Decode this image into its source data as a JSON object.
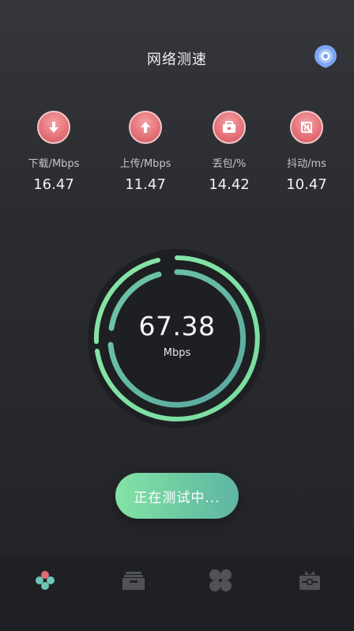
{
  "header": {
    "title": "网络测速",
    "pin_icon": "location-pin-icon"
  },
  "stats": [
    {
      "icon": "download-arrow-icon",
      "label": "下载/Mbps",
      "value": "16.47"
    },
    {
      "icon": "upload-arrow-icon",
      "label": "上传/Mbps",
      "value": "11.47"
    },
    {
      "icon": "briefcase-icon",
      "label": "丢包/%",
      "value": "14.42"
    },
    {
      "icon": "no-signal-icon",
      "label": "抖动/ms",
      "value": "10.47"
    }
  ],
  "gauge": {
    "speed": "67.38",
    "unit": "Mbps"
  },
  "test_button": {
    "label": "正在测试中..."
  },
  "tabbar": [
    {
      "icon": "speed-test-icon",
      "active": true
    },
    {
      "icon": "inbox-tray-icon",
      "active": false
    },
    {
      "icon": "fan-icon",
      "active": false
    },
    {
      "icon": "toolbox-icon",
      "active": false
    }
  ],
  "colors": {
    "accent_green": "#84e3a6",
    "accent_teal": "#5fb5a3",
    "badge_red": "#e26c73",
    "pin_blue": "#7aa6f3"
  }
}
